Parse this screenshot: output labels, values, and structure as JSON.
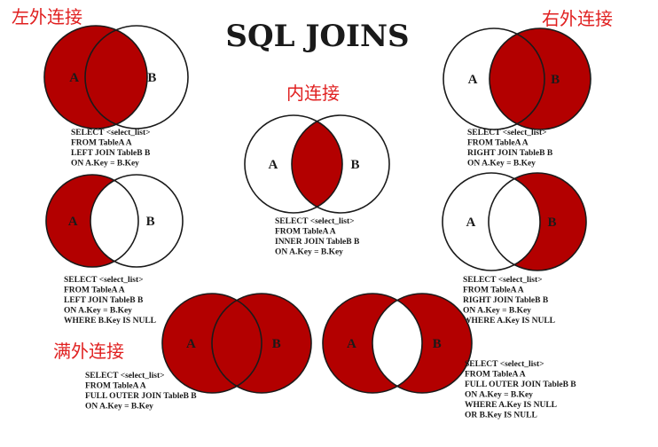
{
  "title": "SQL JOINS",
  "colors": {
    "fill": "#b30000",
    "stroke": "#1a1a1a",
    "caption": "#e02020"
  },
  "captions": {
    "left_join": "左外连接",
    "right_join": "右外连接",
    "inner_join": "内连接",
    "full_join": "满外连接"
  },
  "diagrams": [
    {
      "id": "left-join",
      "highlight": "left-all",
      "label_a": "A",
      "label_b": "B",
      "sql": [
        "SELECT <select_list>",
        "FROM TableA A",
        "LEFT JOIN TableB B",
        "ON A.Key = B.Key"
      ]
    },
    {
      "id": "inner-join",
      "highlight": "intersection",
      "label_a": "A",
      "label_b": "B",
      "sql": [
        "SELECT <select_list>",
        "FROM TableA A",
        "INNER JOIN TableB B",
        "ON A.Key = B.Key"
      ]
    },
    {
      "id": "right-join",
      "highlight": "right-all",
      "label_a": "A",
      "label_b": "B",
      "sql": [
        "SELECT <select_list>",
        "FROM TableA A",
        "RIGHT JOIN TableB B",
        "ON A.Key = B.Key"
      ]
    },
    {
      "id": "left-only",
      "highlight": "left-only",
      "label_a": "A",
      "label_b": "B",
      "sql": [
        "SELECT <select_list>",
        "FROM TableA A",
        "LEFT JOIN TableB B",
        "ON A.Key = B.Key",
        "WHERE B.Key IS NULL"
      ]
    },
    {
      "id": "right-only",
      "highlight": "right-only",
      "label_a": "A",
      "label_b": "B",
      "sql": [
        "SELECT <select_list>",
        "FROM TableA A",
        "RIGHT JOIN TableB B",
        "ON A.Key = B.Key",
        "WHERE A.Key IS NULL"
      ]
    },
    {
      "id": "full-join",
      "highlight": "full",
      "label_a": "A",
      "label_b": "B",
      "sql": [
        "SELECT <select_list>",
        "FROM TableA A",
        "FULL OUTER JOIN TableB B",
        "ON A.Key = B.Key"
      ]
    },
    {
      "id": "full-exclusive",
      "highlight": "exclusive",
      "label_a": "A",
      "label_b": "B",
      "sql": [
        "SELECT <select_list>",
        "FROM TableA A",
        "FULL OUTER JOIN TableB B",
        "ON A.Key = B.Key",
        "WHERE A.Key IS NULL",
        "OR B.Key IS NULL"
      ]
    }
  ]
}
